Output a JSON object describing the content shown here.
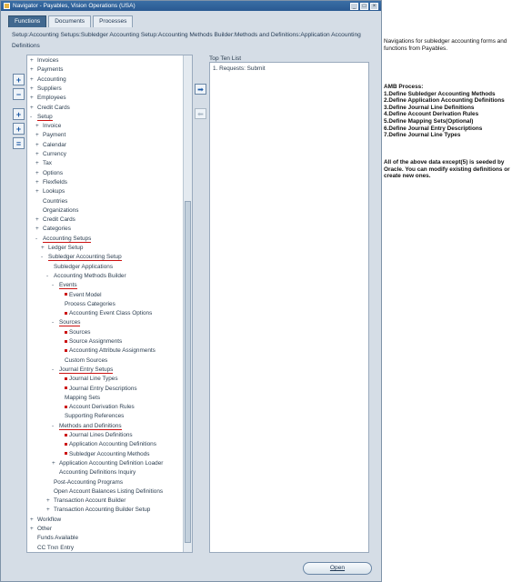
{
  "window": {
    "title": "Navigator - Payables, Vision Operations (USA)",
    "controls": [
      "_",
      "□",
      "×"
    ]
  },
  "tabs": [
    {
      "label": "Functions"
    },
    {
      "label": "Documents"
    },
    {
      "label": "Processes"
    }
  ],
  "breadcrumb": "Setup:Accounting Setups:Subledger Accounting Setup:Accounting Methods Builder:Methods and Definitions:Application Accounting Definitions",
  "side_buttons": [
    "+",
    "−",
    "+",
    "+",
    "≡"
  ],
  "tree": [
    {
      "exp": "+",
      "label": "Invoices",
      "indent": 0
    },
    {
      "exp": "+",
      "label": "Payments",
      "indent": 0
    },
    {
      "exp": "+",
      "label": "Accounting",
      "indent": 0
    },
    {
      "exp": "+",
      "label": "Suppliers",
      "indent": 0
    },
    {
      "exp": "+",
      "label": "Employees",
      "indent": 0
    },
    {
      "exp": "+",
      "label": "Credit Cards",
      "indent": 0
    },
    {
      "exp": "-",
      "label": "Setup",
      "indent": 0,
      "underline": true
    },
    {
      "exp": "+",
      "label": "Invoice",
      "indent": 1
    },
    {
      "exp": "+",
      "label": "Payment",
      "indent": 1
    },
    {
      "exp": "+",
      "label": "Calendar",
      "indent": 1
    },
    {
      "exp": "+",
      "label": "Currency",
      "indent": 1
    },
    {
      "exp": "+",
      "label": "Tax",
      "indent": 1
    },
    {
      "exp": "+",
      "label": "Options",
      "indent": 1
    },
    {
      "exp": "+",
      "label": "Flexfields",
      "indent": 1
    },
    {
      "exp": "+",
      "label": "Lookups",
      "indent": 1
    },
    {
      "exp": "",
      "label": "Countries",
      "indent": 1
    },
    {
      "exp": "",
      "label": "Organizations",
      "indent": 1
    },
    {
      "exp": "+",
      "label": "Credit Cards",
      "indent": 1
    },
    {
      "exp": "+",
      "label": "Categories",
      "indent": 1
    },
    {
      "exp": "-",
      "label": "Accounting Setups",
      "indent": 1,
      "underline": true
    },
    {
      "exp": "+",
      "label": "Ledger Setup",
      "indent": 2
    },
    {
      "exp": "-",
      "label": "Subledger Accounting Setup",
      "indent": 2,
      "underline": true
    },
    {
      "exp": "",
      "label": "Subledger Applications",
      "indent": 3
    },
    {
      "exp": "-",
      "label": "Accounting Methods Builder",
      "indent": 3
    },
    {
      "exp": "-",
      "label": "Events",
      "indent": 4,
      "underline": true
    },
    {
      "exp": "",
      "label": "Event Model",
      "indent": 5,
      "bullet": true
    },
    {
      "exp": "",
      "label": "Process Categories",
      "indent": 5
    },
    {
      "exp": "",
      "label": "Accounting Event Class Options",
      "indent": 5,
      "bullet": true
    },
    {
      "exp": "-",
      "label": "Sources",
      "indent": 4,
      "underline": true
    },
    {
      "exp": "",
      "label": "Sources",
      "indent": 5,
      "bullet": true
    },
    {
      "exp": "",
      "label": "Source Assignments",
      "indent": 5,
      "bullet": true
    },
    {
      "exp": "",
      "label": "Accounting Attribute Assignments",
      "indent": 5,
      "bullet": true
    },
    {
      "exp": "",
      "label": "Custom Sources",
      "indent": 5
    },
    {
      "exp": "-",
      "label": "Journal Entry Setups",
      "indent": 4,
      "underline": true
    },
    {
      "exp": "",
      "label": "Journal Line Types",
      "indent": 5,
      "bullet": true
    },
    {
      "exp": "",
      "label": "Journal Entry Descriptions",
      "indent": 5,
      "bullet": true
    },
    {
      "exp": "",
      "label": "Mapping Sets",
      "indent": 5
    },
    {
      "exp": "",
      "label": "Account Derivation Rules",
      "indent": 5,
      "bullet": true
    },
    {
      "exp": "",
      "label": "Supporting References",
      "indent": 5
    },
    {
      "exp": "-",
      "label": "Methods and Definitions",
      "indent": 4,
      "underline": true
    },
    {
      "exp": "",
      "label": "Journal Lines Definitions",
      "indent": 5,
      "bullet": true
    },
    {
      "exp": "",
      "label": "Application Accounting Definitions",
      "indent": 5,
      "bullet": true
    },
    {
      "exp": "",
      "label": "Subledger Accounting Methods",
      "indent": 5,
      "bullet": true
    },
    {
      "exp": "+",
      "label": "Application Accounting Definition Loader",
      "indent": 4
    },
    {
      "exp": "",
      "label": "Accounting Definitions Inquiry",
      "indent": 4
    },
    {
      "exp": "",
      "label": "Post-Accounting Programs",
      "indent": 3
    },
    {
      "exp": "",
      "label": "Open Account Balances Listing Definitions",
      "indent": 3
    },
    {
      "exp": "+",
      "label": "Transaction Account Builder",
      "indent": 3
    },
    {
      "exp": "+",
      "label": "Transaction Accounting Builder Setup",
      "indent": 3
    },
    {
      "exp": "+",
      "label": "Workflow",
      "indent": 0
    },
    {
      "exp": "+",
      "label": "Other",
      "indent": 0
    },
    {
      "exp": "",
      "label": "Funds Available",
      "indent": 0
    },
    {
      "exp": "",
      "label": "CC Trxn Entry",
      "indent": 0
    }
  ],
  "mid_buttons": [
    "➡",
    "⬅"
  ],
  "top_ten": {
    "label": "Top Ten List",
    "items": [
      "1. Requests: Submit"
    ]
  },
  "open_button": "Open",
  "annotations": {
    "nav_note": "Navigations for subledger accounting forms and functions from Payables.",
    "amb_lines": [
      "AMB Process:",
      "1.Define Subledger Accounting Methods",
      "2.Define Application Accounting Definitions",
      "3.Define Journal Line Definitions",
      "4.Define Account Derivation Rules",
      "5.Define Mapping Sets(Optional)",
      "6.Define Journal Entry Descriptions",
      "7.Define Journal Line Types"
    ],
    "seeded_note": "All of the above data except(5) is seeded by  Oracle. You can modify existing definitions or create new ones."
  }
}
